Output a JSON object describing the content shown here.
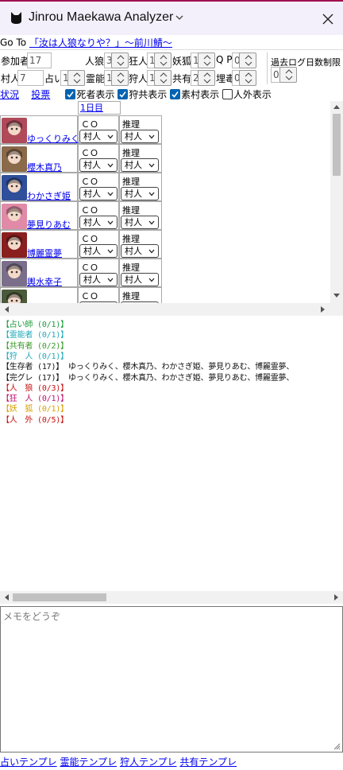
{
  "app": {
    "title": "Jinrou Maekawa Analyzer"
  },
  "goto": {
    "label": "Go To",
    "link": "「汝は人狼なりや？」〜前川鯖〜"
  },
  "counts": {
    "participants_label": "参加者",
    "participants": "17",
    "villager_label": "村人",
    "villager": "7",
    "wolf_label": "人狼",
    "wolf": "3",
    "madman_label": "狂人",
    "madman": "1",
    "fox_label": "妖狐",
    "fox": "1",
    "qp_label": "Q P",
    "qp": "0",
    "seer_label": "占い",
    "seer": "1",
    "medium_label": "霊能",
    "medium": "1",
    "hunter_label": "狩人",
    "hunter": "1",
    "mason_label": "共有",
    "mason": "2",
    "poison_label": "埋毒",
    "poison": "0",
    "pastlog_label": "過去ログ日数制限",
    "pastlog": "0"
  },
  "tabs": {
    "status": "状況",
    "vote": "投票",
    "dead_label": "死者表示",
    "dead_checked": true,
    "hunter_label": "狩共表示",
    "hunter_checked": true,
    "plain_label": "素村表示",
    "plain_checked": true,
    "outside_label": "人外表示",
    "outside_checked": false
  },
  "table": {
    "day_header": "1日目",
    "co_label": "ＣＯ",
    "est_label": "推理",
    "players": [
      {
        "name": "ゆっくりみく",
        "co": "村人",
        "est": "村人",
        "color": "#b04a5a"
      },
      {
        "name": "櫻木真乃",
        "co": "村人",
        "est": "村人",
        "color": "#8a6a4a"
      },
      {
        "name": "わかさぎ姫",
        "co": "村人",
        "est": "村人",
        "color": "#2f4f9a"
      },
      {
        "name": "夢見りあむ",
        "co": "村人",
        "est": "村人",
        "color": "#e08aa8"
      },
      {
        "name": "博麗霊夢",
        "co": "村人",
        "est": "村人",
        "color": "#8a1f1f"
      },
      {
        "name": "輿水幸子",
        "co": "村人",
        "est": "村人",
        "color": "#7a6e8a"
      },
      {
        "name": "",
        "co": "村人",
        "est": "村人",
        "color": "#4a5a3a"
      }
    ]
  },
  "log": [
    {
      "text": "【占い師 (0/1)】",
      "color": "#1a9a3a"
    },
    {
      "text": "【霊能者 (0/1)】",
      "color": "#20a8b8"
    },
    {
      "text": "【共有者 (0/2)】",
      "color": "#3a9a2a"
    },
    {
      "text": "【狩　人 (0/1)】",
      "color": "#20a8b8"
    },
    {
      "text": "【生存者 (17)】 ゆっくりみく、櫻木真乃、わかさぎ姫、夢見りあむ、博麗霊夢、",
      "color": "#111111"
    },
    {
      "text": "【完グレ (17)】 ゆっくりみく、櫻木真乃、わかさぎ姫、夢見りあむ、博麗霊夢、",
      "color": "#111111"
    },
    {
      "text": "【人　狼 (0/3)】",
      "color": "#c81010"
    },
    {
      "text": "【狂　人 (0/1)】",
      "color": "#c01070"
    },
    {
      "text": "【妖　狐 (0/1)】",
      "color": "#d8a000"
    },
    {
      "text": "【人　外 (0/5)】",
      "color": "#c81010"
    }
  ],
  "memo": {
    "placeholder": "メモをどうぞ"
  },
  "templates": {
    "seer": "占いテンプレ",
    "medium": "霊能テンプレ",
    "hunter": "狩人テンプレ",
    "mason": "共有テンプレ"
  }
}
